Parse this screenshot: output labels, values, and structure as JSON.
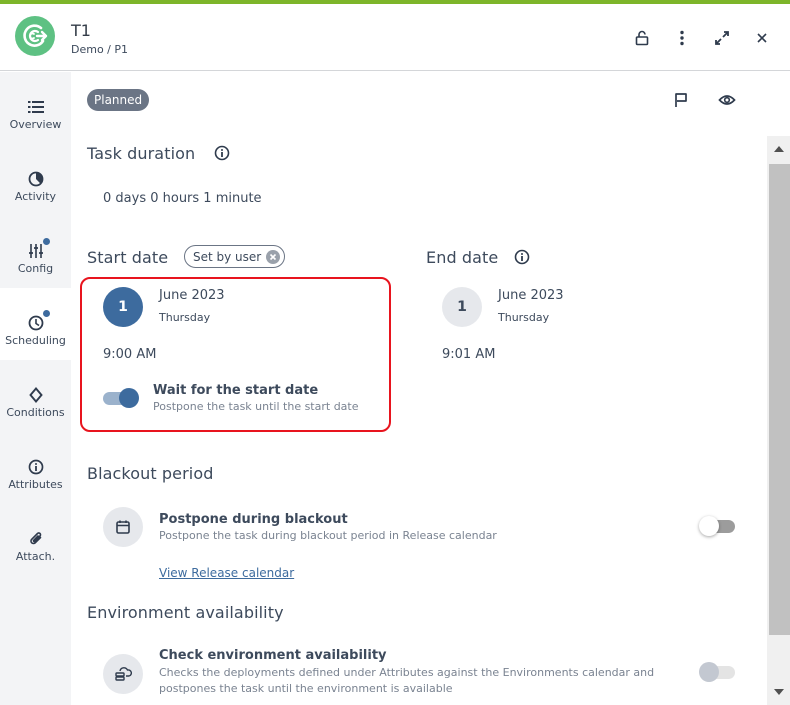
{
  "header": {
    "title": "T1",
    "breadcrumb": "Demo / P1",
    "icons": [
      "unlock-icon",
      "more-vertical-icon",
      "expand-icon",
      "close-icon"
    ]
  },
  "colors": {
    "accent_bar": "#7db52a",
    "logo": "#5ec183",
    "primary": "#3d6b9e",
    "highlight_border": "#e8141e",
    "badge": "#6b7585"
  },
  "sidebar": {
    "items": [
      {
        "label": "Overview",
        "icon": "list-icon",
        "dot": false,
        "active": false
      },
      {
        "label": "Activity",
        "icon": "activity-pie-icon",
        "dot": false,
        "active": false
      },
      {
        "label": "Config",
        "icon": "sliders-icon",
        "dot": true,
        "active": false
      },
      {
        "label": "Scheduling",
        "icon": "clock-icon",
        "dot": true,
        "active": true
      },
      {
        "label": "Conditions",
        "icon": "diamond-icon",
        "dot": false,
        "active": false
      },
      {
        "label": "Attributes",
        "icon": "info-icon",
        "dot": false,
        "active": false
      },
      {
        "label": "Attach.",
        "icon": "paperclip-icon",
        "dot": false,
        "active": false
      }
    ]
  },
  "status": {
    "label": "Planned"
  },
  "task_duration": {
    "heading": "Task duration",
    "value": "0 days 0 hours 1 minute"
  },
  "start_date": {
    "heading": "Start date",
    "chip_label": "Set by user",
    "day": "1",
    "month_year": "June 2023",
    "weekday": "Thursday",
    "time": "9:00 AM",
    "wait_toggle": {
      "title": "Wait for the start date",
      "description": "Postpone the task until the start date",
      "on": true
    }
  },
  "end_date": {
    "heading": "End date",
    "day": "1",
    "month_year": "June 2023",
    "weekday": "Thursday",
    "time": "9:01 AM"
  },
  "blackout": {
    "heading": "Blackout period",
    "title": "Postpone during blackout",
    "description": "Postpone the task during blackout period in Release calendar",
    "link": "View Release calendar",
    "on": false
  },
  "environment": {
    "heading": "Environment availability",
    "title": "Check environment availability",
    "description_line1": "Checks the deployments defined under Attributes against the Environments calendar and",
    "description_line2": "postpones the task until the environment is available",
    "on": false,
    "disabled": true
  }
}
